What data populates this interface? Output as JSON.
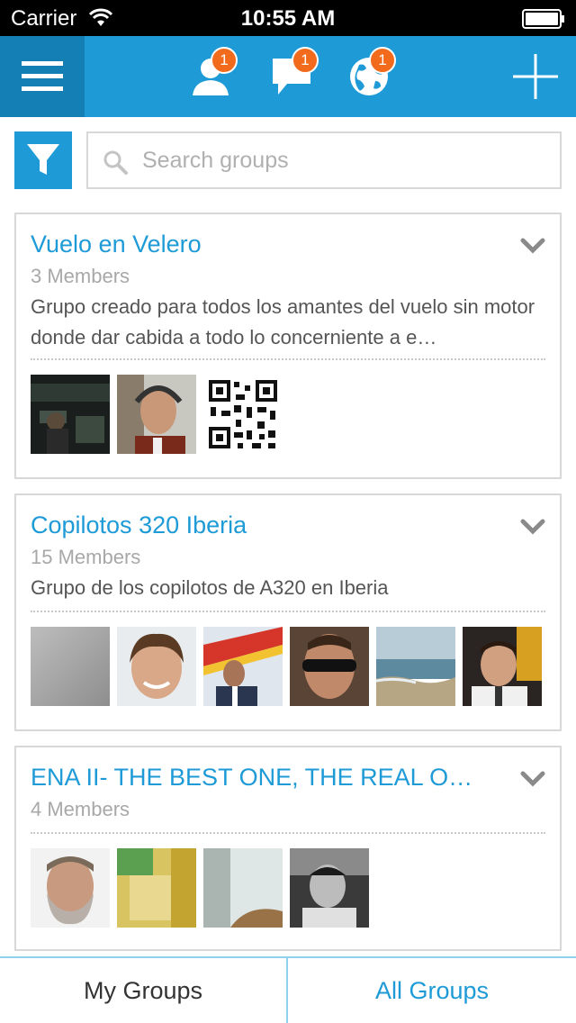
{
  "status_bar": {
    "carrier": "Carrier",
    "time": "10:55 AM"
  },
  "nav": {
    "friends_badge": "1",
    "messages_badge": "1",
    "notifications_badge": "1",
    "accent_color": "#1e9bd7",
    "badge_color": "#f26b1d"
  },
  "search": {
    "placeholder": "Search groups",
    "value": ""
  },
  "groups": [
    {
      "title": "Vuelo en Velero",
      "members": "3 Members",
      "description": "Grupo creado para todos los amantes del vuelo sin motor donde dar cabida a todo lo concerniente a e…"
    },
    {
      "title": "Copilotos 320 Iberia",
      "members": "15 Members",
      "description": "Grupo de los copilotos de A320 en Iberia"
    },
    {
      "title": "ENA II- THE BEST ONE, THE REAL O…",
      "members": "4 Members",
      "description": ""
    }
  ],
  "tabs": {
    "my_groups": "My Groups",
    "all_groups": "All Groups",
    "active": "All Groups"
  }
}
